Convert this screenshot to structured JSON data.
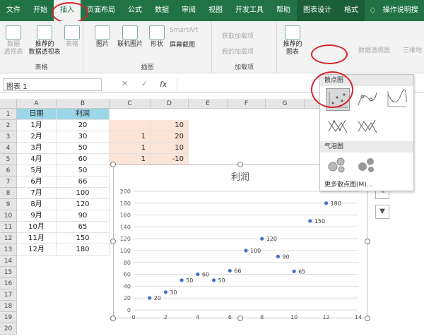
{
  "tabs": [
    "文件",
    "开始",
    "插入",
    "页面布局",
    "公式",
    "数据",
    "审阅",
    "视图",
    "开发工具",
    "帮助",
    "图表设计",
    "格式"
  ],
  "tab_search": "操作说明搜",
  "ribbon": {
    "table_group": {
      "label": "表格",
      "pivot": "数据\n透视表",
      "recommended_pivot": "推荐的\n数据透视表",
      "table": "表格"
    },
    "illustrations": {
      "label": "插图",
      "picture": "图片",
      "online_picture": "联机图片",
      "shapes": "形状",
      "smartart": "SmartArt",
      "screenshot": "屏幕截图"
    },
    "addins": {
      "label": "加载项",
      "get": "获取加载项",
      "my": "我的加载项"
    },
    "charts": {
      "recommended": "推荐的\n图表",
      "pivot_chart": "数据透视图",
      "map3d": "三维地"
    }
  },
  "namebox": "图表 1",
  "fx": "fx",
  "columns": [
    "A",
    "B",
    "C",
    "D",
    "E",
    "F",
    "G",
    "H"
  ],
  "rows": [
    "1",
    "2",
    "3",
    "4",
    "5",
    "6",
    "7",
    "8",
    "9",
    "10",
    "11",
    "12",
    "13",
    "14",
    "15",
    "16",
    "17",
    "18",
    "19",
    "20"
  ],
  "table": {
    "headers": [
      "日期",
      "利润"
    ],
    "rows": [
      [
        "1月",
        "20"
      ],
      [
        "2月",
        "30"
      ],
      [
        "3月",
        "50"
      ],
      [
        "4月",
        "60"
      ],
      [
        "5月",
        "50"
      ],
      [
        "6月",
        "66"
      ],
      [
        "7月",
        "100"
      ],
      [
        "8月",
        "120"
      ],
      [
        "9月",
        "90"
      ],
      [
        "10月",
        "65"
      ],
      [
        "11月",
        "150"
      ],
      [
        "12月",
        "180"
      ]
    ]
  },
  "col_c": [
    "",
    "1",
    "1",
    "1"
  ],
  "col_d": [
    "10",
    "20",
    "10",
    "-10"
  ],
  "dropdown": {
    "scatter_label": "散点图",
    "bubble_label": "气泡图",
    "more": "更多散点图(M)..."
  },
  "chart_data": {
    "type": "scatter",
    "title": "利润",
    "x": [
      1,
      2,
      3,
      4,
      5,
      6,
      7,
      8,
      9,
      10,
      11,
      12
    ],
    "y": [
      20,
      30,
      50,
      60,
      50,
      66,
      100,
      120,
      90,
      65,
      150,
      180
    ],
    "xlim": [
      0,
      14
    ],
    "ylim": [
      0,
      200
    ],
    "xticks": [
      "0",
      "2",
      "4",
      "6",
      "8",
      "10",
      "12",
      "14"
    ],
    "yticks": [
      "0",
      "20",
      "40",
      "60",
      "80",
      "100",
      "120",
      "140",
      "160",
      "180",
      "200"
    ],
    "data_labels": [
      "20",
      "30",
      "50",
      "60",
      "50",
      "66",
      "100",
      "120",
      "90",
      "65",
      "150",
      "180"
    ],
    "marker_color": "#4472c4"
  }
}
